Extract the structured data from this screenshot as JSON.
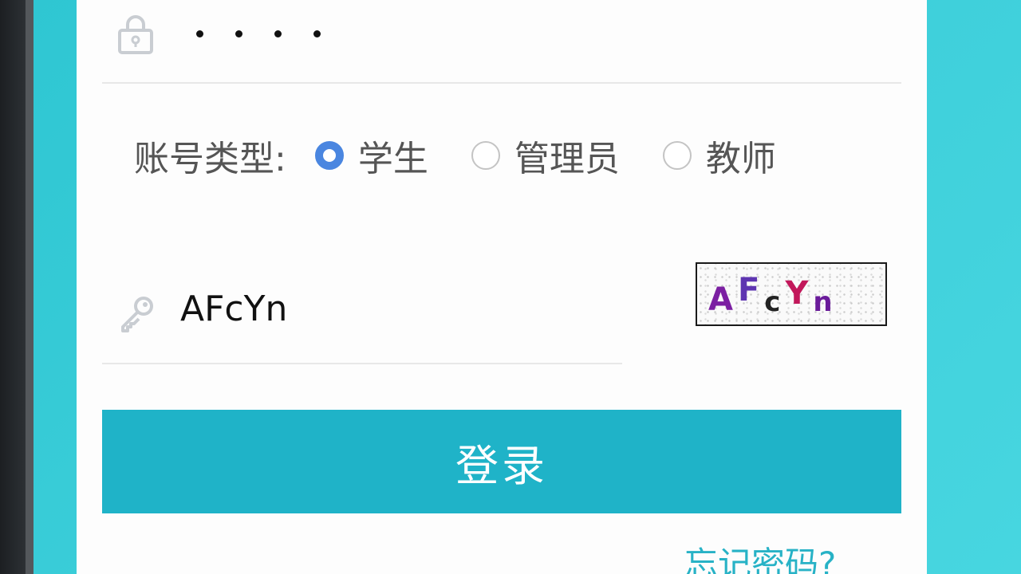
{
  "password": {
    "masked_length": 4
  },
  "account_type": {
    "label": "账号类型:",
    "options": [
      {
        "label": "学生",
        "checked": true
      },
      {
        "label": "管理员",
        "checked": false
      },
      {
        "label": "教师",
        "checked": false
      }
    ]
  },
  "captcha": {
    "input_value": "AFcYn",
    "image_text": [
      "A",
      "F",
      "c",
      "Y",
      "n"
    ]
  },
  "login": {
    "button_label": "登录"
  },
  "forgot": {
    "link_text": "忘记密码?"
  },
  "colors": {
    "accent": "#1fb3c8",
    "radio_checked": "#4a86e0",
    "link": "#27b2c6",
    "background": "#3fd0db"
  },
  "icons": {
    "password_field": "lock-icon",
    "captcha_field": "key-icon"
  }
}
